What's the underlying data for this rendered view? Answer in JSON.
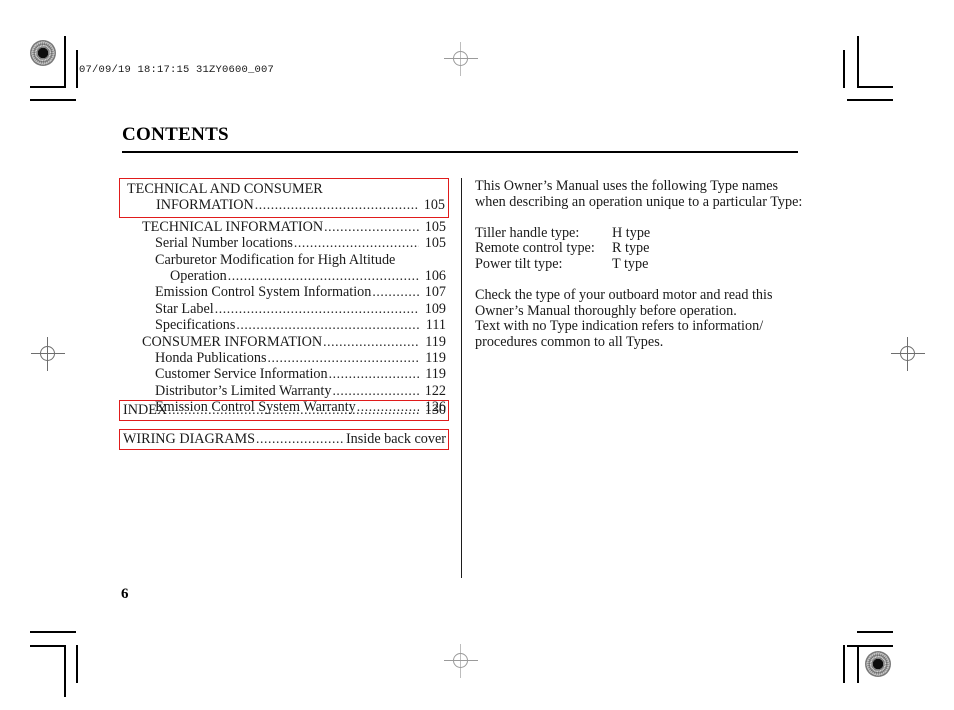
{
  "slug": "07/09/19 18:17:15 31ZY0600_007",
  "page": {
    "title": "CONTENTS",
    "folio": "6"
  },
  "colors": {
    "highlight_box": "#e01b1b",
    "rule": "#000000",
    "text": "#1a1a1a"
  },
  "toc": {
    "leader_dots": "......................................................................................................",
    "groups": [
      {
        "name": "technical-and-consumer-information",
        "boxed": true,
        "rows": [
          {
            "label": "TECHNICAL AND CONSUMER",
            "page": "",
            "indent": "lvl0",
            "leader": false
          },
          {
            "label": "INFORMATION",
            "page": "105",
            "indent": "lvl0w",
            "leader": true
          }
        ]
      },
      {
        "name": "technical-information",
        "boxed": false,
        "rows": [
          {
            "label": "TECHNICAL INFORMATION",
            "page": "105",
            "indent": "lvl1",
            "leader": true
          },
          {
            "label": "Serial Number locations",
            "page": "105",
            "indent": "lvl2",
            "leader": true
          },
          {
            "label": "Carburetor Modification for High Altitude",
            "page": "",
            "indent": "lvl2",
            "leader": false
          },
          {
            "label": "Operation",
            "page": "106",
            "indent": "lvl3",
            "leader": true
          },
          {
            "label": "Emission Control System Information",
            "page": "107",
            "indent": "lvl2",
            "leader": true
          },
          {
            "label": "Star Label",
            "page": "109",
            "indent": "lvl2",
            "leader": true
          },
          {
            "label": "Specifications",
            "page": "111",
            "indent": "lvl2",
            "leader": true
          },
          {
            "label": "CONSUMER INFORMATION",
            "page": "119",
            "indent": "lvl1",
            "leader": true
          },
          {
            "label": "Honda Publications",
            "page": "119",
            "indent": "lvl2",
            "leader": true
          },
          {
            "label": "Customer Service Information",
            "page": "119",
            "indent": "lvl2",
            "leader": true
          },
          {
            "label": "Distributor’s Limited Warranty",
            "page": "122",
            "indent": "lvl2",
            "leader": true
          },
          {
            "label": "Emission Control System Warranty",
            "page": "126",
            "indent": "lvl2",
            "leader": true
          }
        ]
      }
    ],
    "index_entry": {
      "label": "INDEX",
      "page": "130",
      "boxed": true
    },
    "wiring_entry": {
      "label": "WIRING DIAGRAMS",
      "page": "Inside back cover",
      "boxed": true
    }
  },
  "notes": {
    "intro_line1": "This Owner’s Manual uses the following Type names",
    "intro_line2": "when describing an operation unique to a particular Type:",
    "types": [
      {
        "name": "Tiller handle type:",
        "value": "H type"
      },
      {
        "name": "Remote control type:",
        "value": "R type"
      },
      {
        "name": "Power tilt type:",
        "value": "T type"
      }
    ],
    "closing_line1": "Check the type of your outboard motor and read this",
    "closing_line2": "Owner’s Manual thoroughly before operation.",
    "closing_line3": "Text with no Type indication refers to information/",
    "closing_line4": "procedures common to all Types."
  }
}
